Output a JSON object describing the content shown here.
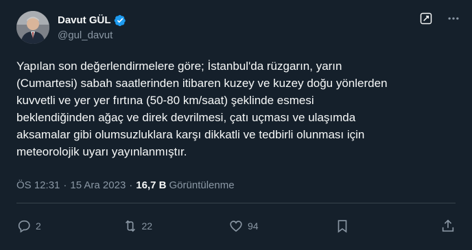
{
  "author": {
    "display_name": "Davut GÜL",
    "handle": "@gul_davut",
    "verified": true
  },
  "tweet": {
    "text": "Yapılan son değerlendirmelere göre; İstanbul'da rüzgarın, yarın\n(Cumartesi) sabah saatlerinden itibaren kuzey ve kuzey doğu yönlerden\nkuvvetli ve yer yer fırtına (50-80 km/saat) şeklinde esmesi\nbeklendiğinden ağaç ve direk devrilmesi, çatı uçması ve ulaşımda\naksamalar gibi olumsuzluklara karşı dikkatli ve tedbirli olunması için\nmeteorolojik uyarı yayınlanmıştır.",
    "time": "ÖS 12:31",
    "date": "15 Ara 2023",
    "views_count": "16,7 B",
    "views_label": "Görüntülenme"
  },
  "stats": {
    "replies": "2",
    "reposts": "22",
    "likes": "94"
  },
  "colors": {
    "background": "#15202b",
    "text": "#f7f9f9",
    "muted": "#8b98a5",
    "verified": "#1d9bf0",
    "divider": "#38444d"
  },
  "icons": {
    "top_left": "grok-icon",
    "top_right": "more-icon",
    "reply": "reply-icon",
    "repost": "repost-icon",
    "like": "like-icon",
    "bookmark": "bookmark-icon",
    "share": "share-icon"
  }
}
